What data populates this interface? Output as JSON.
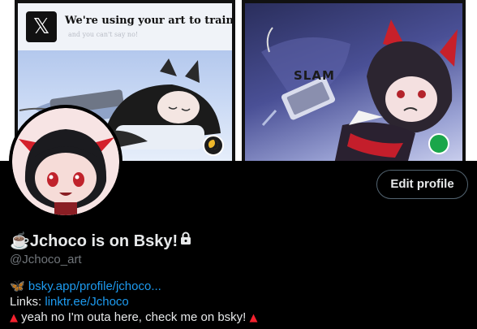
{
  "banner": {
    "left_panel": {
      "tweet_headline": "We're using your art to train our AI!",
      "tweet_subtext": "and you can't say no!",
      "logo_icon": "x-logo-icon",
      "status_icon": "moon-icon"
    },
    "right_panel": {
      "sound_effect": "SLAM",
      "status_icon": "green-dot-icon"
    }
  },
  "profile": {
    "edit_button_label": "Edit profile",
    "display_name": "☕Jchoco is on Bsky!",
    "handle": "@Jchoco_art",
    "protected_icon": "lock-icon",
    "bio": {
      "line1_emoji": "🦋",
      "line1_link": "bsky.app/profile/jchoco...",
      "line2_label": "Links:",
      "line2_link": "linktr.ee/Jchoco",
      "line3_text": "yeah no I'm outa here, check me on bsky!",
      "line3_marker": "▲"
    }
  },
  "colors": {
    "background": "#000000",
    "link": "#1d9bf0",
    "secondary_text": "#71767b",
    "marker": "#f4212e"
  }
}
